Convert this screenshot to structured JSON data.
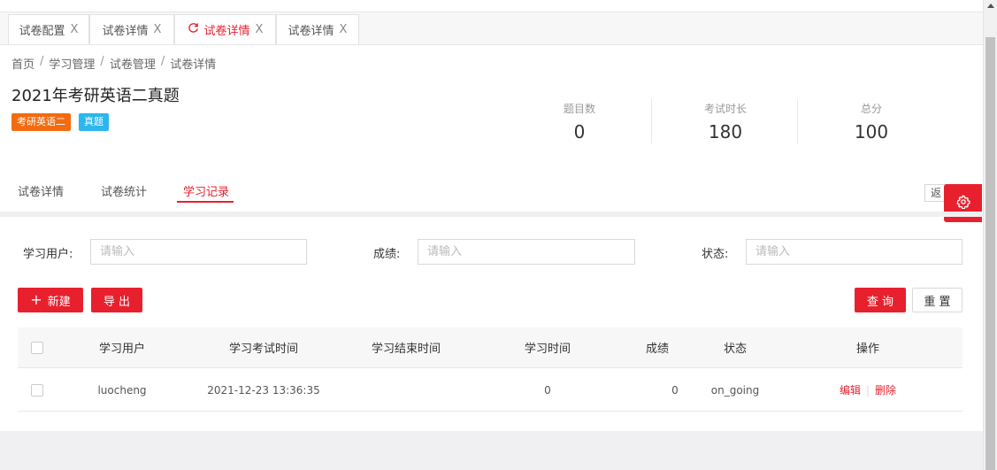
{
  "tabs": [
    {
      "label": "试卷配置",
      "close": "X"
    },
    {
      "label": "试卷详情",
      "close": "X"
    },
    {
      "label": "试卷详情",
      "close": "X",
      "active": true
    },
    {
      "label": "试卷详情",
      "close": "X"
    }
  ],
  "breadcrumb": [
    "首页",
    "学习管理",
    "试卷管理",
    "试卷详情"
  ],
  "breadcrumb_sep": "/",
  "page_title": "2021年考研英语二真题",
  "tags": [
    {
      "label": "考研英语二",
      "color": "#f36b0f"
    },
    {
      "label": "真题",
      "color": "#2bb6ee"
    }
  ],
  "stats": [
    {
      "label": "题目数",
      "value": "0"
    },
    {
      "label": "考试时长",
      "value": "180"
    },
    {
      "label": "总分",
      "value": "100"
    }
  ],
  "subtabs": [
    "试卷详情",
    "试卷统计",
    "学习记录"
  ],
  "back_label": "返回",
  "form": {
    "user_label": "学习用户:",
    "score_label": "成绩:",
    "status_label": "状态:",
    "placeholder": "请输入"
  },
  "buttons": {
    "new": "新建",
    "export": "导 出",
    "query": "查 询",
    "reset": "重 置"
  },
  "table": {
    "headers": [
      "学习用户",
      "学习考试时间",
      "学习结束时间",
      "学习时间",
      "成绩",
      "状态",
      "操作"
    ],
    "rows": [
      {
        "user": "luocheng",
        "start_time": "2021-12-23 13:36:35",
        "end_time": "",
        "study_time": "0",
        "score": "0",
        "status": "on_going",
        "edit": "编辑",
        "delete": "删除"
      }
    ]
  },
  "colors": {
    "accent": "#e8202e"
  }
}
